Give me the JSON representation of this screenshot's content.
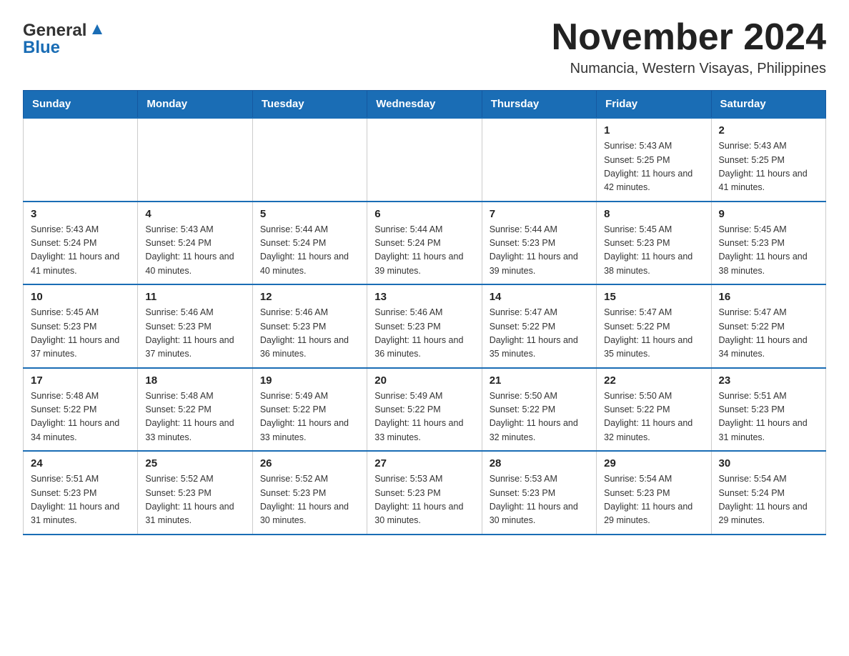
{
  "header": {
    "logo_general": "General",
    "logo_blue": "Blue",
    "month_title": "November 2024",
    "location": "Numancia, Western Visayas, Philippines"
  },
  "days_of_week": [
    "Sunday",
    "Monday",
    "Tuesday",
    "Wednesday",
    "Thursday",
    "Friday",
    "Saturday"
  ],
  "weeks": [
    [
      {
        "day": "",
        "info": ""
      },
      {
        "day": "",
        "info": ""
      },
      {
        "day": "",
        "info": ""
      },
      {
        "day": "",
        "info": ""
      },
      {
        "day": "",
        "info": ""
      },
      {
        "day": "1",
        "info": "Sunrise: 5:43 AM\nSunset: 5:25 PM\nDaylight: 11 hours and 42 minutes."
      },
      {
        "day": "2",
        "info": "Sunrise: 5:43 AM\nSunset: 5:25 PM\nDaylight: 11 hours and 41 minutes."
      }
    ],
    [
      {
        "day": "3",
        "info": "Sunrise: 5:43 AM\nSunset: 5:24 PM\nDaylight: 11 hours and 41 minutes."
      },
      {
        "day": "4",
        "info": "Sunrise: 5:43 AM\nSunset: 5:24 PM\nDaylight: 11 hours and 40 minutes."
      },
      {
        "day": "5",
        "info": "Sunrise: 5:44 AM\nSunset: 5:24 PM\nDaylight: 11 hours and 40 minutes."
      },
      {
        "day": "6",
        "info": "Sunrise: 5:44 AM\nSunset: 5:24 PM\nDaylight: 11 hours and 39 minutes."
      },
      {
        "day": "7",
        "info": "Sunrise: 5:44 AM\nSunset: 5:23 PM\nDaylight: 11 hours and 39 minutes."
      },
      {
        "day": "8",
        "info": "Sunrise: 5:45 AM\nSunset: 5:23 PM\nDaylight: 11 hours and 38 minutes."
      },
      {
        "day": "9",
        "info": "Sunrise: 5:45 AM\nSunset: 5:23 PM\nDaylight: 11 hours and 38 minutes."
      }
    ],
    [
      {
        "day": "10",
        "info": "Sunrise: 5:45 AM\nSunset: 5:23 PM\nDaylight: 11 hours and 37 minutes."
      },
      {
        "day": "11",
        "info": "Sunrise: 5:46 AM\nSunset: 5:23 PM\nDaylight: 11 hours and 37 minutes."
      },
      {
        "day": "12",
        "info": "Sunrise: 5:46 AM\nSunset: 5:23 PM\nDaylight: 11 hours and 36 minutes."
      },
      {
        "day": "13",
        "info": "Sunrise: 5:46 AM\nSunset: 5:23 PM\nDaylight: 11 hours and 36 minutes."
      },
      {
        "day": "14",
        "info": "Sunrise: 5:47 AM\nSunset: 5:22 PM\nDaylight: 11 hours and 35 minutes."
      },
      {
        "day": "15",
        "info": "Sunrise: 5:47 AM\nSunset: 5:22 PM\nDaylight: 11 hours and 35 minutes."
      },
      {
        "day": "16",
        "info": "Sunrise: 5:47 AM\nSunset: 5:22 PM\nDaylight: 11 hours and 34 minutes."
      }
    ],
    [
      {
        "day": "17",
        "info": "Sunrise: 5:48 AM\nSunset: 5:22 PM\nDaylight: 11 hours and 34 minutes."
      },
      {
        "day": "18",
        "info": "Sunrise: 5:48 AM\nSunset: 5:22 PM\nDaylight: 11 hours and 33 minutes."
      },
      {
        "day": "19",
        "info": "Sunrise: 5:49 AM\nSunset: 5:22 PM\nDaylight: 11 hours and 33 minutes."
      },
      {
        "day": "20",
        "info": "Sunrise: 5:49 AM\nSunset: 5:22 PM\nDaylight: 11 hours and 33 minutes."
      },
      {
        "day": "21",
        "info": "Sunrise: 5:50 AM\nSunset: 5:22 PM\nDaylight: 11 hours and 32 minutes."
      },
      {
        "day": "22",
        "info": "Sunrise: 5:50 AM\nSunset: 5:22 PM\nDaylight: 11 hours and 32 minutes."
      },
      {
        "day": "23",
        "info": "Sunrise: 5:51 AM\nSunset: 5:23 PM\nDaylight: 11 hours and 31 minutes."
      }
    ],
    [
      {
        "day": "24",
        "info": "Sunrise: 5:51 AM\nSunset: 5:23 PM\nDaylight: 11 hours and 31 minutes."
      },
      {
        "day": "25",
        "info": "Sunrise: 5:52 AM\nSunset: 5:23 PM\nDaylight: 11 hours and 31 minutes."
      },
      {
        "day": "26",
        "info": "Sunrise: 5:52 AM\nSunset: 5:23 PM\nDaylight: 11 hours and 30 minutes."
      },
      {
        "day": "27",
        "info": "Sunrise: 5:53 AM\nSunset: 5:23 PM\nDaylight: 11 hours and 30 minutes."
      },
      {
        "day": "28",
        "info": "Sunrise: 5:53 AM\nSunset: 5:23 PM\nDaylight: 11 hours and 30 minutes."
      },
      {
        "day": "29",
        "info": "Sunrise: 5:54 AM\nSunset: 5:23 PM\nDaylight: 11 hours and 29 minutes."
      },
      {
        "day": "30",
        "info": "Sunrise: 5:54 AM\nSunset: 5:24 PM\nDaylight: 11 hours and 29 minutes."
      }
    ]
  ]
}
